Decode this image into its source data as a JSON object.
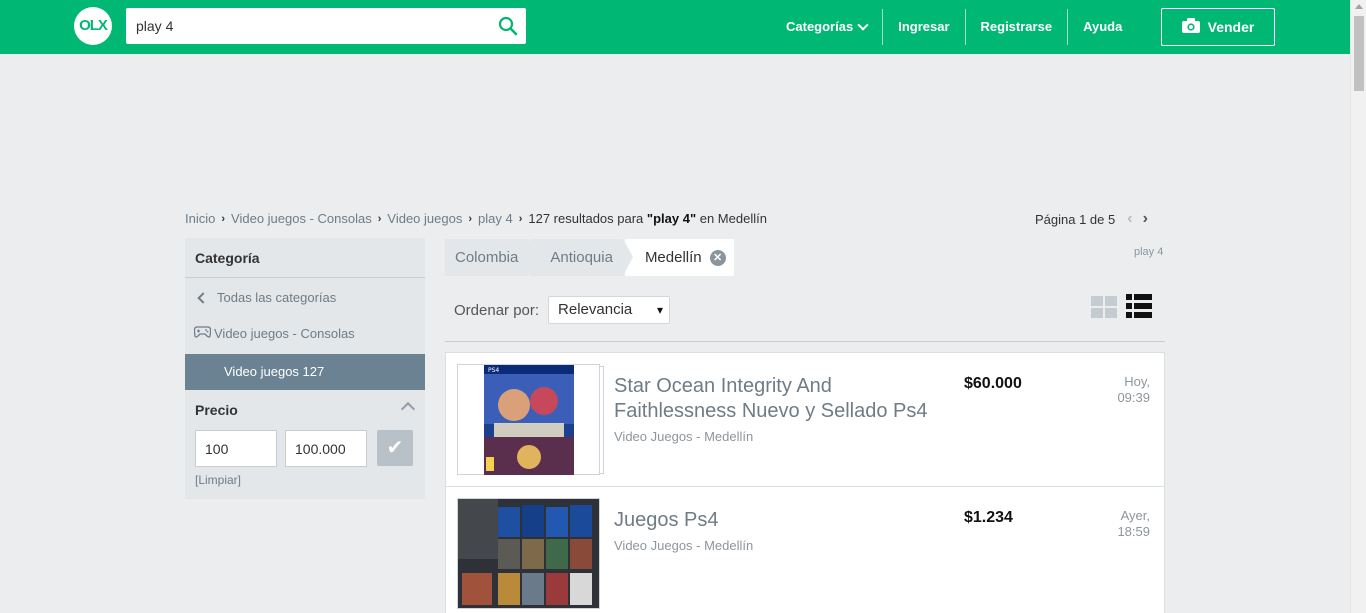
{
  "header": {
    "logo_text": "OLX",
    "search_value": "play 4",
    "nav": [
      "Categorías",
      "Ingresar",
      "Registrarse",
      "Ayuda"
    ],
    "sell_label": "Vender",
    "brand_color": "#00b773"
  },
  "breadcrumb": {
    "items": [
      "Inicio",
      "Video juegos - Consolas",
      "Video juegos",
      "play 4"
    ],
    "results_prefix": "127 resultados para",
    "results_query": "\"play 4\"",
    "results_suffix": "en Medellín"
  },
  "pager": {
    "label": "Página 1 de 5"
  },
  "sidebar": {
    "category_title": "Categoría",
    "all_categories": "Todas las categorías",
    "parent_category": "Video juegos - Consolas",
    "active_category": "Video juegos 127",
    "price_title": "Precio",
    "price_min": "100",
    "price_max": "100.000",
    "clear_label": "[Limpiar]"
  },
  "location": {
    "items": [
      "Colombia",
      "Antioquia",
      "Medellín"
    ],
    "search_tag": "play 4"
  },
  "sort": {
    "label": "Ordenar por:",
    "selected": "Relevancia"
  },
  "listings": [
    {
      "title": "Star Ocean Integrity And Faithlessness Nuevo y Sellado Ps4",
      "subtitle": "Video Juegos - Medellín",
      "price": "$60.000",
      "day": "Hoy,",
      "time": "09:39"
    },
    {
      "title": "Juegos Ps4",
      "subtitle": "Video Juegos - Medellín",
      "price": "$1.234",
      "day": "Ayer,",
      "time": "18:59"
    }
  ]
}
